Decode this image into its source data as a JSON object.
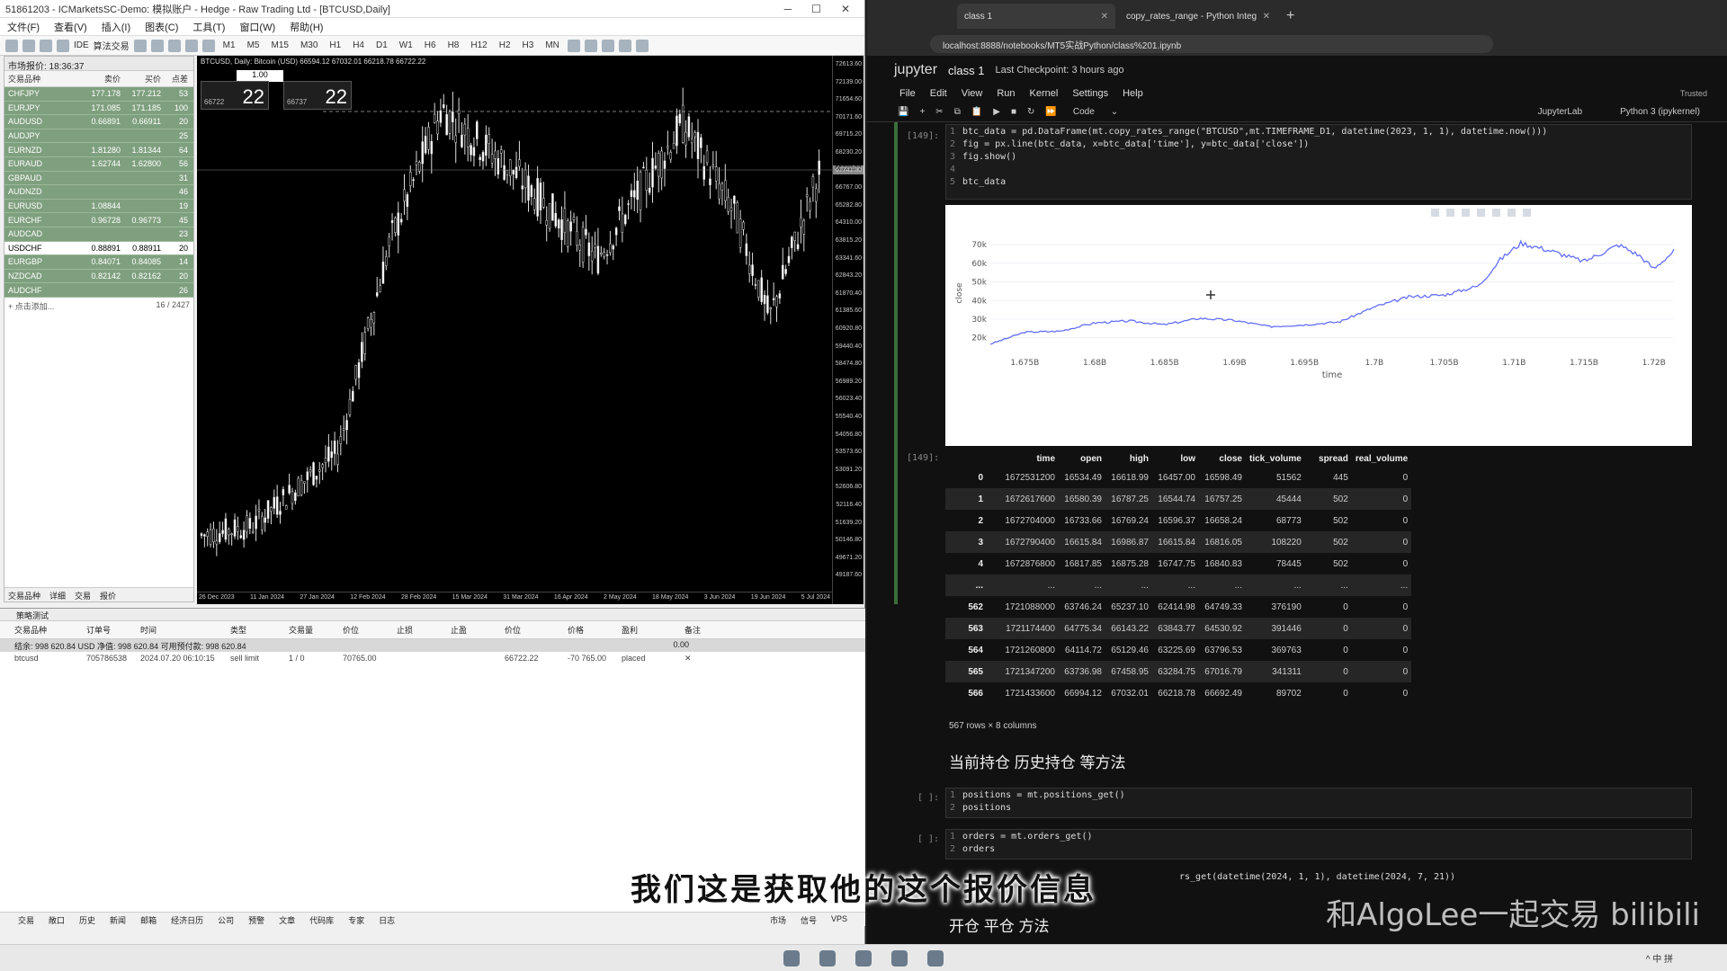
{
  "mt5": {
    "title": "51861203 - ICMarketsSC-Demo: 模拟账户 - Hedge - Raw Trading Ltd - [BTCUSD,Daily]",
    "menu": [
      "文件(F)",
      "查看(V)",
      "插入(I)",
      "图表(C)",
      "工具(T)",
      "窗口(W)",
      "帮助(H)"
    ],
    "toolbar": {
      "algo": "算法交易",
      "ide": "IDE",
      "timeframes": [
        "M1",
        "M5",
        "M15",
        "M30",
        "H1",
        "H4",
        "D1",
        "W1",
        "H6",
        "H8",
        "H12",
        "H2",
        "H3",
        "MN"
      ]
    },
    "market_watch": {
      "title": "市场报价: 18:36:37",
      "cols": [
        "交易品种",
        "卖价",
        "买价",
        "点差"
      ],
      "rows": [
        {
          "sym": "CHFJPY",
          "bid": "177.178",
          "ask": "177.212",
          "spread": "53"
        },
        {
          "sym": "EURJPY",
          "bid": "171.085",
          "ask": "171.185",
          "spread": "100"
        },
        {
          "sym": "AUDUSD",
          "bid": "0.66891",
          "ask": "0.66911",
          "spread": "20"
        },
        {
          "sym": "AUDJPY",
          "bid": "",
          "ask": "",
          "spread": "25"
        },
        {
          "sym": "EURNZD",
          "bid": "1.81280",
          "ask": "1.81344",
          "spread": "64"
        },
        {
          "sym": "EURAUD",
          "bid": "1.62744",
          "ask": "1.62800",
          "spread": "56"
        },
        {
          "sym": "GBPAUD",
          "bid": "",
          "ask": "",
          "spread": "31"
        },
        {
          "sym": "AUDNZD",
          "bid": "",
          "ask": "",
          "spread": "46"
        },
        {
          "sym": "EURUSD",
          "bid": "1.08844",
          "ask": "",
          "spread": "19"
        },
        {
          "sym": "EURCHF",
          "bid": "0.96728",
          "ask": "0.96773",
          "spread": "45"
        },
        {
          "sym": "AUDCAD",
          "bid": "",
          "ask": "",
          "spread": "23"
        },
        {
          "sym": "USDCHF",
          "bid": "0.88891",
          "ask": "0.88911",
          "spread": "20"
        },
        {
          "sym": "EURGBP",
          "bid": "0.84071",
          "ask": "0.84085",
          "spread": "14"
        },
        {
          "sym": "NZDCAD",
          "bid": "0.82142",
          "ask": "0.82162",
          "spread": "20"
        },
        {
          "sym": "AUDCHF",
          "bid": "",
          "ask": "",
          "spread": "26"
        }
      ],
      "add": "+ 点击添加...",
      "count": "16 / 2427",
      "tabs": [
        "交易品种",
        "详细",
        "交易",
        "报价"
      ]
    },
    "chart": {
      "header": "BTCUSD, Daily: Bitcoin (USD)  66594.12 67032.01 66218.78 66722.22",
      "lot": "1.00",
      "sell": {
        "small": "66722",
        "big": "22"
      },
      "buy": {
        "small": "66737",
        "big": "22"
      },
      "prices": [
        "72613.60",
        "72139.00",
        "71654.60",
        "70171.60",
        "69715.20",
        "68230.20",
        "67741.80",
        "66767.00",
        "65282.80",
        "64310.00",
        "63815.20",
        "63341.60",
        "62843.20",
        "61870.40",
        "61385.60",
        "60920.80",
        "59440.40",
        "58474.80",
        "56989.20",
        "56023.40",
        "55540.40",
        "54056.80",
        "53573.60",
        "53091.20",
        "52606.80",
        "52116.40",
        "51639.20",
        "50146.80",
        "49671.20",
        "49187.60"
      ],
      "current": "66722.22",
      "dates": [
        "26 Dec 2023",
        "11 Jan 2024",
        "27 Jan 2024",
        "12 Feb 2024",
        "28 Feb 2024",
        "15 Mar 2024",
        "31 Mar 2024",
        "16 Apr 2024",
        "2 May 2024",
        "18 May 2024",
        "3 Jun 2024",
        "19 Jun 2024",
        "5 Jul 2024"
      ]
    },
    "toolbox": {
      "header": "策略测试",
      "cols": [
        "交易品种",
        "订单号",
        "时间",
        "类型",
        "交易量",
        "价位",
        "止损",
        "止盈",
        "价位",
        "价格",
        "盈利",
        "备注"
      ],
      "balance": "结余: 998 620.84 USD  净值: 998 620.84  可用预付款: 998 620.84",
      "balance_right": "0.00",
      "order": {
        "sym": "btcusd",
        "ticket": "705786538",
        "time": "2024.07.20 06:10:15",
        "type": "sell limit",
        "vol": "1 / 0",
        "price": "70765.00",
        "cur": "66722.22",
        "diff": "-70 765.00",
        "state": "placed"
      },
      "tabs": [
        "交易",
        "敞口",
        "历史",
        "新闻",
        "邮箱",
        "经济日历",
        "公司",
        "预警",
        "文章",
        "代码库",
        "专家",
        "日志"
      ],
      "right_tabs": [
        "市场",
        "信号",
        "VPS"
      ]
    }
  },
  "browser": {
    "tabs": [
      {
        "label": "class 1"
      },
      {
        "label": "copy_rates_range - Python Integ"
      }
    ],
    "url": "localhost:8888/notebooks/MT5实战Python/class%201.ipynb",
    "jupyter": {
      "logo": "jupyter",
      "name": "class 1",
      "checkpoint": "Last Checkpoint: 3 hours ago",
      "menu": [
        "File",
        "Edit",
        "View",
        "Run",
        "Kernel",
        "Settings",
        "Help"
      ],
      "trusted": "Trusted",
      "celltype": "Code",
      "jupyterlab": "JupyterLab",
      "kernel": "Python 3 (ipykernel)"
    },
    "cell1": {
      "prompt": "[149]:",
      "lines": [
        "btc_data = pd.DataFrame(mt.copy_rates_range(\"BTCUSD\",mt.TIMEFRAME_D1, datetime(2023, 1, 1), datetime.now()))",
        "fig = px.line(btc_data, x=btc_data['time'], y=btc_data['close'])",
        "fig.show()",
        "",
        "btc_data"
      ]
    },
    "out_prompt": "[149]:",
    "df": {
      "cols": [
        "",
        "time",
        "open",
        "high",
        "low",
        "close",
        "tick_volume",
        "spread",
        "real_volume"
      ],
      "rows": [
        [
          "0",
          "1672531200",
          "16534.49",
          "16618.99",
          "16457.00",
          "16598.49",
          "51562",
          "445",
          "0"
        ],
        [
          "1",
          "1672617600",
          "16580.39",
          "16787.25",
          "16544.74",
          "16757.25",
          "45444",
          "502",
          "0"
        ],
        [
          "2",
          "1672704000",
          "16733.66",
          "16769.24",
          "16596.37",
          "16658.24",
          "68773",
          "502",
          "0"
        ],
        [
          "3",
          "1672790400",
          "16615.84",
          "16986.87",
          "16615.84",
          "16816.05",
          "108220",
          "502",
          "0"
        ],
        [
          "4",
          "1672876800",
          "16817.85",
          "16875.28",
          "16747.75",
          "16840.83",
          "78445",
          "502",
          "0"
        ],
        [
          "...",
          "...",
          "...",
          "...",
          "...",
          "...",
          "...",
          "...",
          "..."
        ],
        [
          "562",
          "1721088000",
          "63746.24",
          "65237.10",
          "62414.98",
          "64749.33",
          "376190",
          "0",
          "0"
        ],
        [
          "563",
          "1721174400",
          "64775.34",
          "66143.22",
          "63843.77",
          "64530.92",
          "391446",
          "0",
          "0"
        ],
        [
          "564",
          "1721260800",
          "64114.72",
          "65129.46",
          "63225.69",
          "63796.53",
          "369763",
          "0",
          "0"
        ],
        [
          "565",
          "1721347200",
          "63736.98",
          "67458.95",
          "63284.75",
          "67016.79",
          "341311",
          "0",
          "0"
        ],
        [
          "566",
          "1721433600",
          "66994.12",
          "67032.01",
          "66218.78",
          "66692.49",
          "89702",
          "0",
          "0"
        ]
      ],
      "shape": "567 rows × 8 columns"
    },
    "md": "当前持仓 历史持仓 等方法",
    "cell2": {
      "prompt": "[ ]:",
      "lines": [
        "positions = mt.positions_get()",
        "positions"
      ]
    },
    "cell3": {
      "prompt": "[ ]:",
      "lines": [
        "orders = mt.orders_get()",
        "orders"
      ]
    },
    "cell4": {
      "line": "rs_get(datetime(2024, 1, 1), datetime(2024, 7, 21))"
    },
    "md2": "开仓 平仓 方法"
  },
  "chart_data": {
    "type": "line",
    "xlabel": "time",
    "ylabel": "close",
    "x_ticks": [
      "1.675B",
      "1.68B",
      "1.685B",
      "1.69B",
      "1.695B",
      "1.7B",
      "1.705B",
      "1.71B",
      "1.715B",
      "1.72B"
    ],
    "y_ticks": [
      "20k",
      "30k",
      "40k",
      "50k",
      "60k",
      "70k"
    ],
    "xlim": [
      1672531200,
      1721433600
    ],
    "ylim": [
      15000,
      73000
    ],
    "x": [
      1672531200,
      1675000000,
      1677500000,
      1680000000,
      1682500000,
      1685000000,
      1687500000,
      1690000000,
      1692500000,
      1695000000,
      1697500000,
      1700000000,
      1702500000,
      1705000000,
      1707500000,
      1709000000,
      1710500000,
      1712500000,
      1715000000,
      1717500000,
      1719000000,
      1720000000,
      1721433600
    ],
    "y": [
      16598,
      23000,
      23500,
      28000,
      29000,
      27000,
      30500,
      29300,
      26000,
      27000,
      28500,
      36500,
      42000,
      43000,
      48000,
      62000,
      71000,
      67000,
      61000,
      70000,
      64000,
      57000,
      66692
    ]
  },
  "overlay": {
    "subtitle": "我们这是获取他的这个报价信息",
    "watermark": "和AlgoLee一起交易 bilibili"
  }
}
